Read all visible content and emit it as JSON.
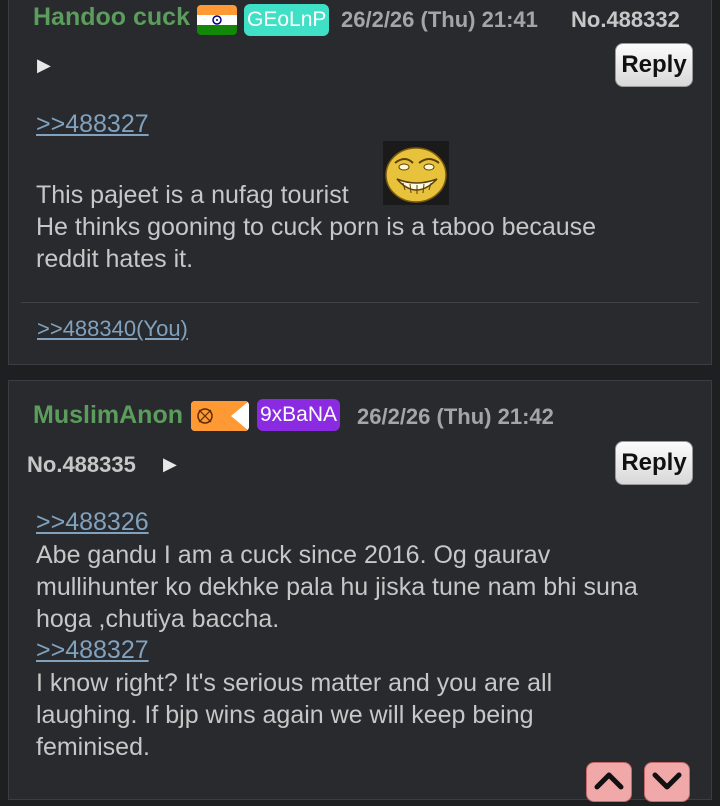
{
  "posts": [
    {
      "name": "Handoo cuck",
      "flag": "india-flag",
      "id": "GEoLnP",
      "id_color": "#3fe0c5",
      "datetime": "26/2/26 (Thu) 21:41",
      "number": "No.488332",
      "reply_label": "Reply",
      "quote": ">>488327",
      "text_line1": "This pajeet is a nufag tourist",
      "text_line2": "He thinks gooning to cuck porn is a taboo because",
      "text_line3": "reddit hates it.",
      "backlink": ">>488340(You)"
    },
    {
      "name": "MuslimAnon",
      "flag": "saffron-flag",
      "id": "9xBaNA",
      "id_color": "#8a2be2",
      "datetime": "26/2/26 (Thu) 21:42",
      "number": "No.488335",
      "reply_label": "Reply",
      "quote1": ">>488326",
      "text1_line1": "Abe gandu I am a cuck since 2016. Og gaurav",
      "text1_line2": "mullihunter ko dekhke pala hu jiska tune nam bhi suna",
      "text1_line3": "hoga ,chutiya baccha.",
      "quote2": ">>488327",
      "text2_line1": "I know right? It's serious matter and you are all",
      "text2_line2": "laughing. If bjp wins again we will keep being",
      "text2_line3": "feminised."
    }
  ],
  "colors": {
    "background": "#1d1f21",
    "post_background": "#282a2e",
    "name": "#5c9c5c",
    "link": "#81a2be"
  }
}
